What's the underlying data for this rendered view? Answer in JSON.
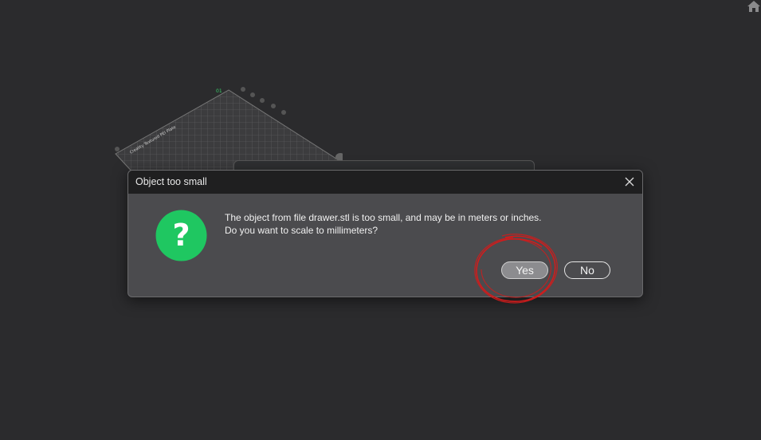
{
  "dialog": {
    "title": "Object too small",
    "message_line1": "The object from file drawer.stl is too small, and may be in meters or inches.",
    "message_line2": "Do you want to scale to millimeters?",
    "yes_label": "Yes",
    "no_label": "No",
    "icon": "question-icon",
    "icon_color": "#1fc761"
  },
  "toolbar": {
    "home_icon": "home-icon"
  },
  "colors": {
    "background": "#2b2b2d",
    "dialog_bg": "#4b4b4e",
    "titlebar_bg": "#1f1f20",
    "annotation": "#d01c1c"
  }
}
